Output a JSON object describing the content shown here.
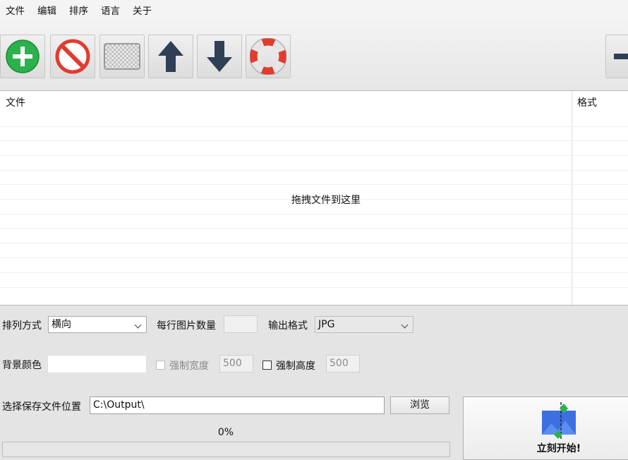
{
  "menu": [
    "文件",
    "编辑",
    "排序",
    "语言",
    "关于"
  ],
  "toolbar": {
    "buttons": [
      {
        "icon": "add-icon"
      },
      {
        "icon": "remove-icon"
      },
      {
        "icon": "clear-icon"
      },
      {
        "icon": "move-up-icon"
      },
      {
        "icon": "move-down-icon"
      },
      {
        "icon": "help-icon"
      },
      {
        "icon": "minimize-icon"
      }
    ]
  },
  "filelist": {
    "columns": [
      "文件",
      "格式"
    ],
    "drop_hint": "拖拽文件到这里"
  },
  "options": {
    "arrange_label": "排列方式",
    "arrange_value": "横向",
    "per_row_label": "每行图片数量",
    "per_row_value": "",
    "format_label": "输出格式",
    "format_value": "JPG",
    "bg_color_label": "背景颜色",
    "bg_color_value": "",
    "force_width_label": "强制宽度",
    "force_width_value": "500",
    "force_height_label": "强制高度",
    "force_height_value": "500",
    "save_location_label": "选择保存文件位置",
    "save_location_value": "C:\\Output\\",
    "browse_label": "浏览"
  },
  "progress": {
    "text": "0%",
    "value": 0
  },
  "start": {
    "label": "立刻开始!"
  },
  "colors": {
    "add": "#2bb24c",
    "remove": "#e23b2f",
    "arrow": "#2f3f55",
    "accent": "#3d6fe0"
  }
}
